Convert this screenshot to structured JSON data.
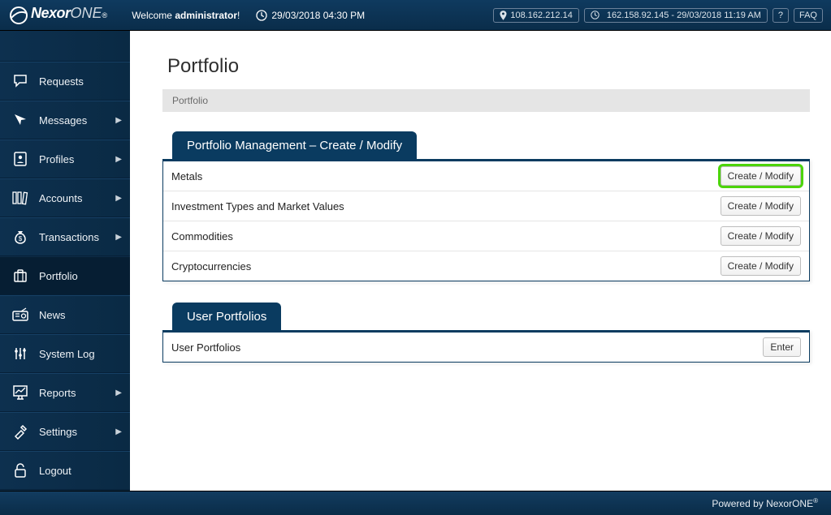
{
  "header": {
    "logo": {
      "nexor": "Nexor",
      "one": "ONE",
      "reg": "®"
    },
    "welcome_prefix": "Welcome ",
    "welcome_user": "administrator",
    "welcome_suffix": "!",
    "datetime": "29/03/2018 04:30 PM",
    "ip_badge": "108.162.212.14",
    "last_login_badge": "162.158.92.145 - 29/03/2018 11:19 AM",
    "help_label": "?",
    "faq_label": "FAQ"
  },
  "sidebar": {
    "items": [
      {
        "label": "Requests",
        "icon": "speech-icon",
        "has_sub": false
      },
      {
        "label": "Messages",
        "icon": "cursor-icon",
        "has_sub": true
      },
      {
        "label": "Profiles",
        "icon": "profile-icon",
        "has_sub": true
      },
      {
        "label": "Accounts",
        "icon": "books-icon",
        "has_sub": true
      },
      {
        "label": "Transactions",
        "icon": "moneybag-icon",
        "has_sub": true
      },
      {
        "label": "Portfolio",
        "icon": "suitcase-icon",
        "has_sub": false,
        "active": true
      },
      {
        "label": "News",
        "icon": "radio-icon",
        "has_sub": false
      },
      {
        "label": "System Log",
        "icon": "sliders-icon",
        "has_sub": false
      },
      {
        "label": "Reports",
        "icon": "chart-icon",
        "has_sub": true
      },
      {
        "label": "Settings",
        "icon": "tools-icon",
        "has_sub": true
      },
      {
        "label": "Logout",
        "icon": "lock-icon",
        "has_sub": false
      }
    ]
  },
  "page": {
    "title": "Portfolio",
    "breadcrumb": "Portfolio"
  },
  "panel_manage": {
    "title": "Portfolio Management – Create / Modify",
    "rows": [
      {
        "label": "Metals",
        "button": "Create / Modify",
        "highlight": true
      },
      {
        "label": "Investment Types and Market Values",
        "button": "Create / Modify",
        "highlight": false
      },
      {
        "label": "Commodities",
        "button": "Create / Modify",
        "highlight": false
      },
      {
        "label": "Cryptocurrencies",
        "button": "Create / Modify",
        "highlight": false
      }
    ]
  },
  "panel_user": {
    "title": "User Portfolios",
    "rows": [
      {
        "label": "User Portfolios",
        "button": "Enter"
      }
    ]
  },
  "footer": {
    "text": "Powered by NexorONE",
    "reg": "®"
  }
}
